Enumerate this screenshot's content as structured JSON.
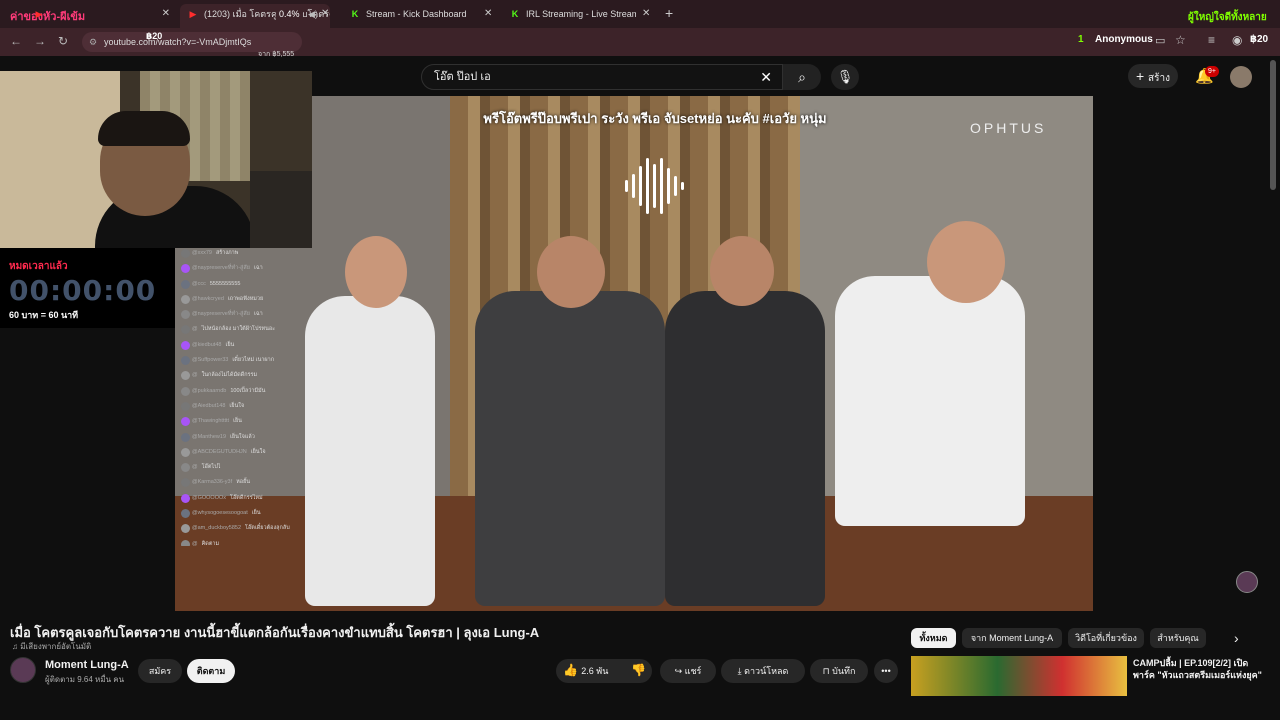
{
  "browser": {
    "overlay_left_text": "ค่าของหัว-ผีเข้ม",
    "tabs": [
      {
        "label": "",
        "icon": "youtube-icon"
      },
      {
        "label": "(1203) เมื่อ โคตรคูลเจอกับโคตรควาย",
        "icon": "youtube-icon"
      },
      {
        "label": "Stream - Kick Dashboard",
        "icon": "kick-icon"
      },
      {
        "label": "IRL Streaming - Live Streams o",
        "icon": "kick-icon"
      }
    ],
    "overlay_percent": "0.4%",
    "overlay_right_text": "ผู้ใหญ่ใจดีทั้งหลาย",
    "url": "youtube.com/watch?v=-VmADjmtIQs",
    "donation_top": "฿20",
    "donation_sub": "จาก ฿5,555",
    "viewer_count": "1",
    "viewer_name": "Anonymous",
    "donation_right": "฿20"
  },
  "youtube": {
    "search_query": "โอ๊ต ป๊อป เอ",
    "create_label": "สร้าง",
    "notif_count": "9+"
  },
  "video": {
    "caption": "พรีโอ๊ตพรีป๊อบพรีเปา ระวัง พรีเอ จับsetหย่อ นะคับ #เอวัย หนุ่ม",
    "brand": "OPHTUS"
  },
  "stream_overlay": {
    "timer_label": "หมดเวลาแล้ว",
    "timer": "00:00:00",
    "rate": "60 บาท = 60 นาที"
  },
  "chat": [
    {
      "user": "@xxx79",
      "msg": "สร้างภาพ"
    },
    {
      "user": "@naypreserveที่ทำ-สู่สัย",
      "msg": "เฉา"
    },
    {
      "user": "@ccc",
      "msg": "5555555555"
    },
    {
      "user": "@hawkcryed",
      "msg": "เถาพอฟังหมวย"
    },
    {
      "user": "@naypreserveที่ทำ-สู่สัย",
      "msg": "เฉา"
    },
    {
      "user": "@",
      "msg": "ไปหน้อกล้อง มาใต้ฝ้าโปรทนอะ"
    },
    {
      "user": "@kiedbut48",
      "msg": "เย็น"
    },
    {
      "user": "@Suffpower33",
      "msg": "เดี๋ยวไหม่ เนาผาก"
    },
    {
      "user": "@",
      "msg": "ในกล้องไม่ได้มัดดีกรรม"
    },
    {
      "user": "@pukkaarndb",
      "msg": "100เปิ้ลว่ามีมัน"
    },
    {
      "user": "@Aiedbut148",
      "msg": "เย็นใจ"
    },
    {
      "user": "@Thawinghttttt",
      "msg": "เย็น"
    },
    {
      "user": "@Manthew19",
      "msg": "เย็นใจแล้ว"
    },
    {
      "user": "@ABCDEGUTUDHJN",
      "msg": "เย็นใจ"
    },
    {
      "user": "@",
      "msg": "โอ๊ตไปไ"
    },
    {
      "user": "@Karma336-y3f",
      "msg": "หอยั้น"
    },
    {
      "user": "@GOOOOOx",
      "msg": "โอ๊ตดีกรรไหม่"
    },
    {
      "user": "@whysogoesesoogoat",
      "msg": "เย็น"
    },
    {
      "user": "@am_duckboy5852",
      "msg": "โอ๊ตเดี๋ยวต้องลุกลับ"
    },
    {
      "user": "@",
      "msg": "คิดตาม"
    }
  ],
  "watch": {
    "title": "เมื่อ โคตรคูลเจอกับโคตรควาย งานนี้ฮาขี้แตกล้อกันเรื่องคางขำแทบสิ้น โคตรฮา | ลุงเอ Lung-A",
    "dub_note": "มีเสียงพากย์อัตโนมัติ",
    "channel": "Moment Lung-A",
    "subscribers": "ผู้ติดตาม 9.64 หมื่น คน",
    "join_label": "สมัคร",
    "subscribe_label": "ติดตาม",
    "likes": "2.6 พัน",
    "share_label": "แชร์",
    "download_label": "ดาวน์โหลด",
    "save_label": "บันทึก"
  },
  "chips": [
    "ทั้งหมด",
    "จาก Moment Lung-A",
    "วิดีโอที่เกี่ยวข้อง",
    "สำหรับคุณ"
  ],
  "related": {
    "title": "CAMPปลื้ม | EP.109[2/2] เปิดพาร์ค \"หัวแถวสตรีมเมอร์แห่งยุค\""
  }
}
